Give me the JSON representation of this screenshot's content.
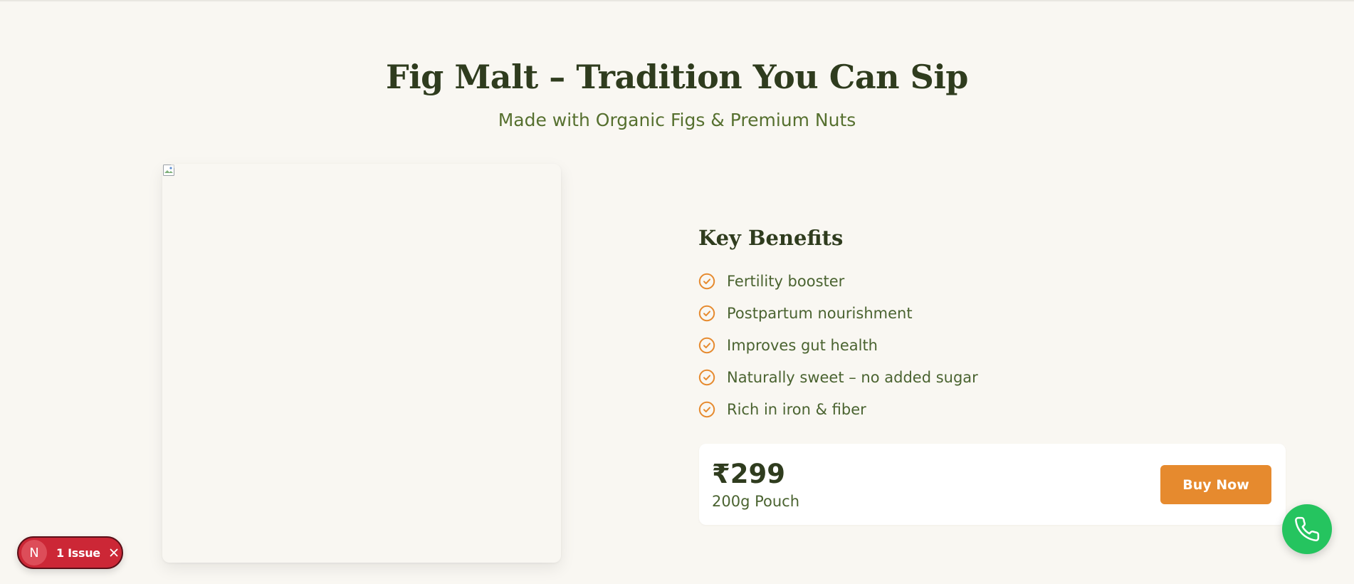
{
  "hero": {
    "title": "Fig Malt – Tradition You Can Sip",
    "subtitle": "Made with Organic Figs & Premium Nuts"
  },
  "product_image": {
    "icon": "broken-image-icon"
  },
  "benefits": {
    "title": "Key Benefits",
    "icon": "check-circle-icon",
    "icon_color": "#e68a2e",
    "items": [
      "Fertility booster",
      "Postpartum nourishment",
      "Improves gut health",
      "Naturally sweet – no added sugar",
      "Rich in iron & fiber"
    ]
  },
  "pricing": {
    "price": "₹299",
    "size": "200g Pouch",
    "buy_label": "Buy Now",
    "button_color": "#e68a2e"
  },
  "call_button": {
    "icon": "phone-icon",
    "color": "#25c45f"
  },
  "dev_overlay": {
    "logo_letter": "N",
    "issues_label": "1 Issue",
    "color": "#cc2736"
  }
}
